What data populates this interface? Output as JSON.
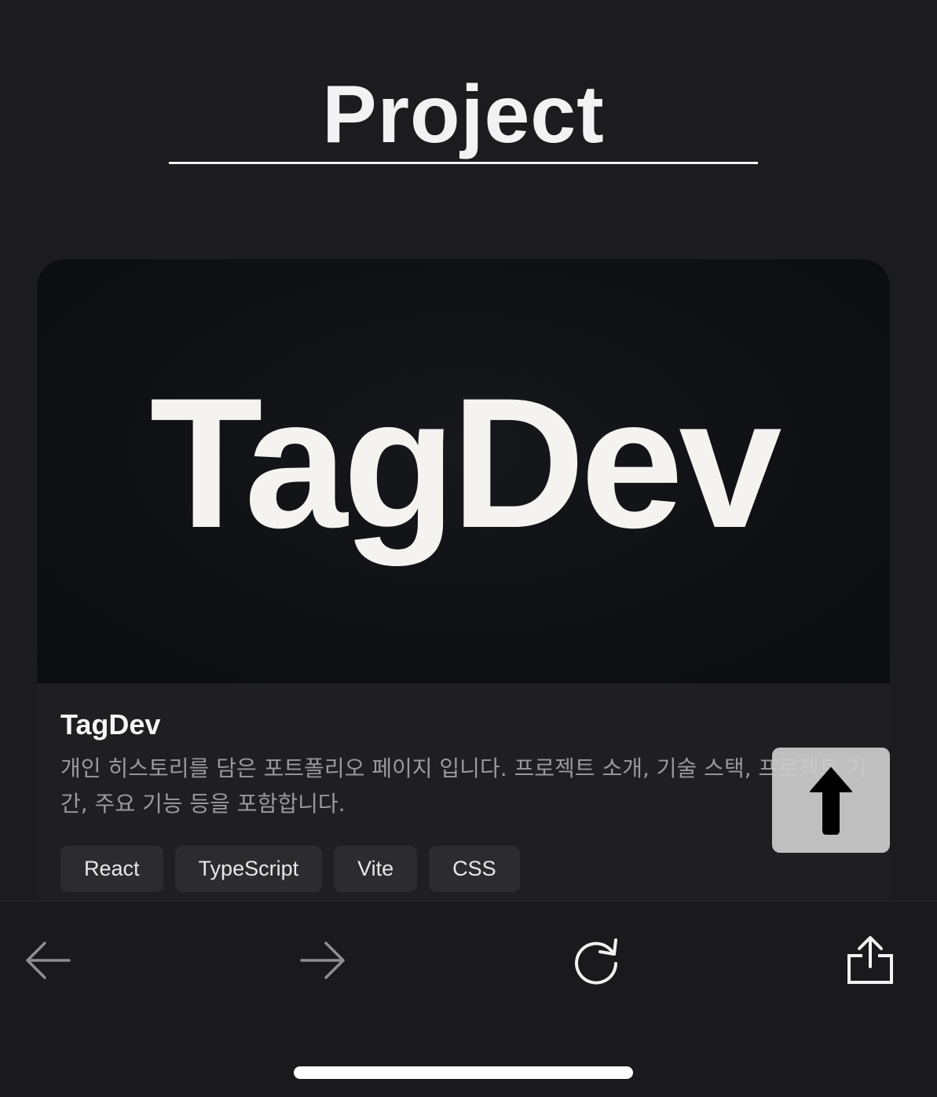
{
  "section": {
    "title": "Project"
  },
  "project_card": {
    "image_text": "TagDev",
    "title": "TagDev",
    "description": "개인 히스토리를 담은 포트폴리오 페이지 입니다. 프로젝트 소개, 기술 스택, 프로젝트 기간, 주요 기능 등을 포함합니다.",
    "tags": [
      "React",
      "TypeScript",
      "Vite",
      "CSS"
    ]
  },
  "scroll_top_button": {
    "icon": "arrow-up-icon"
  },
  "browser_toolbar": {
    "back_icon": "arrow-left-icon",
    "forward_icon": "arrow-right-icon",
    "reload_icon": "reload-icon",
    "share_icon": "share-icon"
  },
  "colors": {
    "background": "#1c1c1e",
    "card_background": "#1f1f21",
    "tag_background": "#2c2c2e",
    "text_primary": "#f5f5f5",
    "text_secondary": "#9a9a9c"
  }
}
